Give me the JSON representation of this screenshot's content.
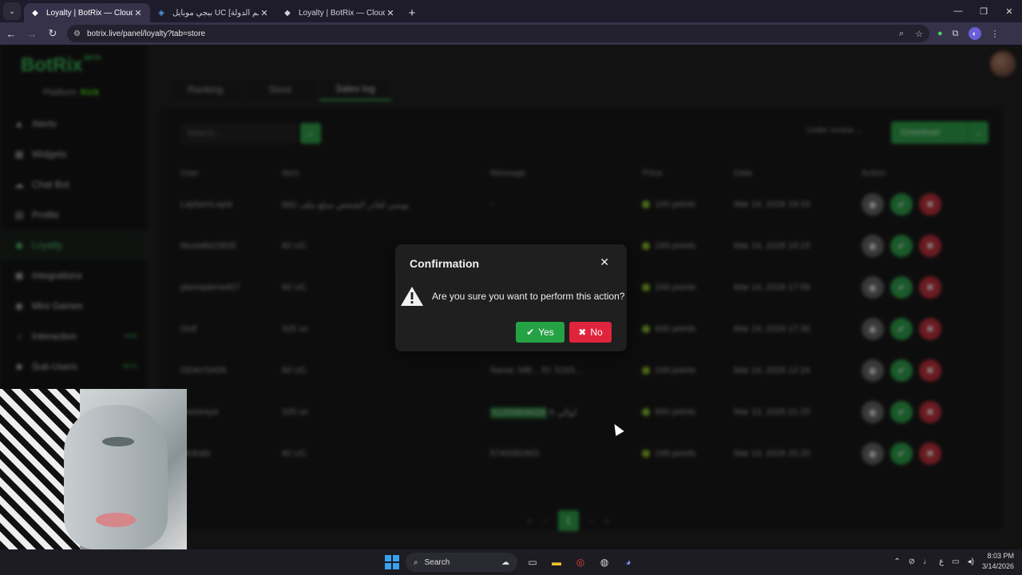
{
  "browser": {
    "tabs": [
      {
        "title": "Loyalty | BotRix — Cloud Stream",
        "active": true
      },
      {
        "title": "ببجي موبايل UC [اسم الدولة] خ...",
        "active": false
      },
      {
        "title": "Loyalty | BotRix — Cloud Stream",
        "active": false
      }
    ],
    "url": "botrix.live/panel/loyalty?tab=store"
  },
  "sidebar": {
    "logo": "BotRix",
    "logo_badge": "BETA",
    "platform_label": "Platform:",
    "platform_name": "Kick",
    "items": [
      {
        "label": "Alerts",
        "icon": "bell-icon"
      },
      {
        "label": "Widgets",
        "icon": "grid-icon"
      },
      {
        "label": "Chat Bot",
        "icon": "cloud-icon"
      },
      {
        "label": "Profile",
        "icon": "card-icon"
      },
      {
        "label": "Loyalty",
        "icon": "diamond-icon",
        "active": true
      },
      {
        "label": "Integrations",
        "icon": "plug-icon"
      },
      {
        "label": "Mini Games",
        "icon": "gamepad-icon"
      },
      {
        "label": "Interaction",
        "icon": "music-icon",
        "badge": "NEW"
      },
      {
        "label": "Sub-Users",
        "icon": "users-icon",
        "badge": "BETA"
      }
    ]
  },
  "main": {
    "tabs": [
      "Ranking",
      "Store",
      "Sales log"
    ],
    "search_placeholder": "Search...",
    "filter_label": "Under review",
    "download_label": "Download",
    "columns": [
      "User",
      "Item",
      "Message",
      "Price",
      "Date",
      "Action"
    ],
    "rows": [
      {
        "user": "LaylaonLayla",
        "item": "660 يوسي لعادر الشخص مبلغ ملف",
        "message": "-",
        "price": "100 points",
        "date": "Mar 14, 2026 19:33"
      },
      {
        "user": "Mustafa15835",
        "item": "60 UC",
        "message": "",
        "price": "249 points",
        "date": "Mar 14, 2026 19:15"
      },
      {
        "user": "pierrepierre407",
        "item": "60 UC",
        "message": "",
        "price": "249 points",
        "date": "Mar 14, 2026 17:58"
      },
      {
        "user": "Octf",
        "item": "325 uc",
        "message": "",
        "price": "600 points",
        "date": "Mar 14, 2026 17:36"
      },
      {
        "user": "ODAYSA09",
        "item": "60 UC",
        "message": "Name: MB... ID: 5183...",
        "price": "249 points",
        "date": "Mar 14, 2026 12:24"
      },
      {
        "user": "oussireya",
        "item": "325 uc",
        "message_hl": "51255806626",
        "message": "6 لوالي",
        "price": "600 points",
        "date": "Mar 13, 2026 21:25"
      },
      {
        "user": "Mrdrabi",
        "item": "60 UC",
        "message": "5740082463",
        "price": "249 points",
        "date": "Mar 13, 2026 20:20"
      }
    ],
    "pager_current": "1"
  },
  "modal": {
    "title": "Confirmation",
    "text": "Are you sure you want to perform this action?",
    "yes_label": "Yes",
    "no_label": "No"
  },
  "taskbar": {
    "search_label": "Search",
    "time": "8:03 PM",
    "date": "3/14/2026",
    "lang": "ع"
  },
  "colors": {
    "accent": "#25a244",
    "danger": "#e0243c",
    "modal_bg": "#1f1f1f"
  }
}
